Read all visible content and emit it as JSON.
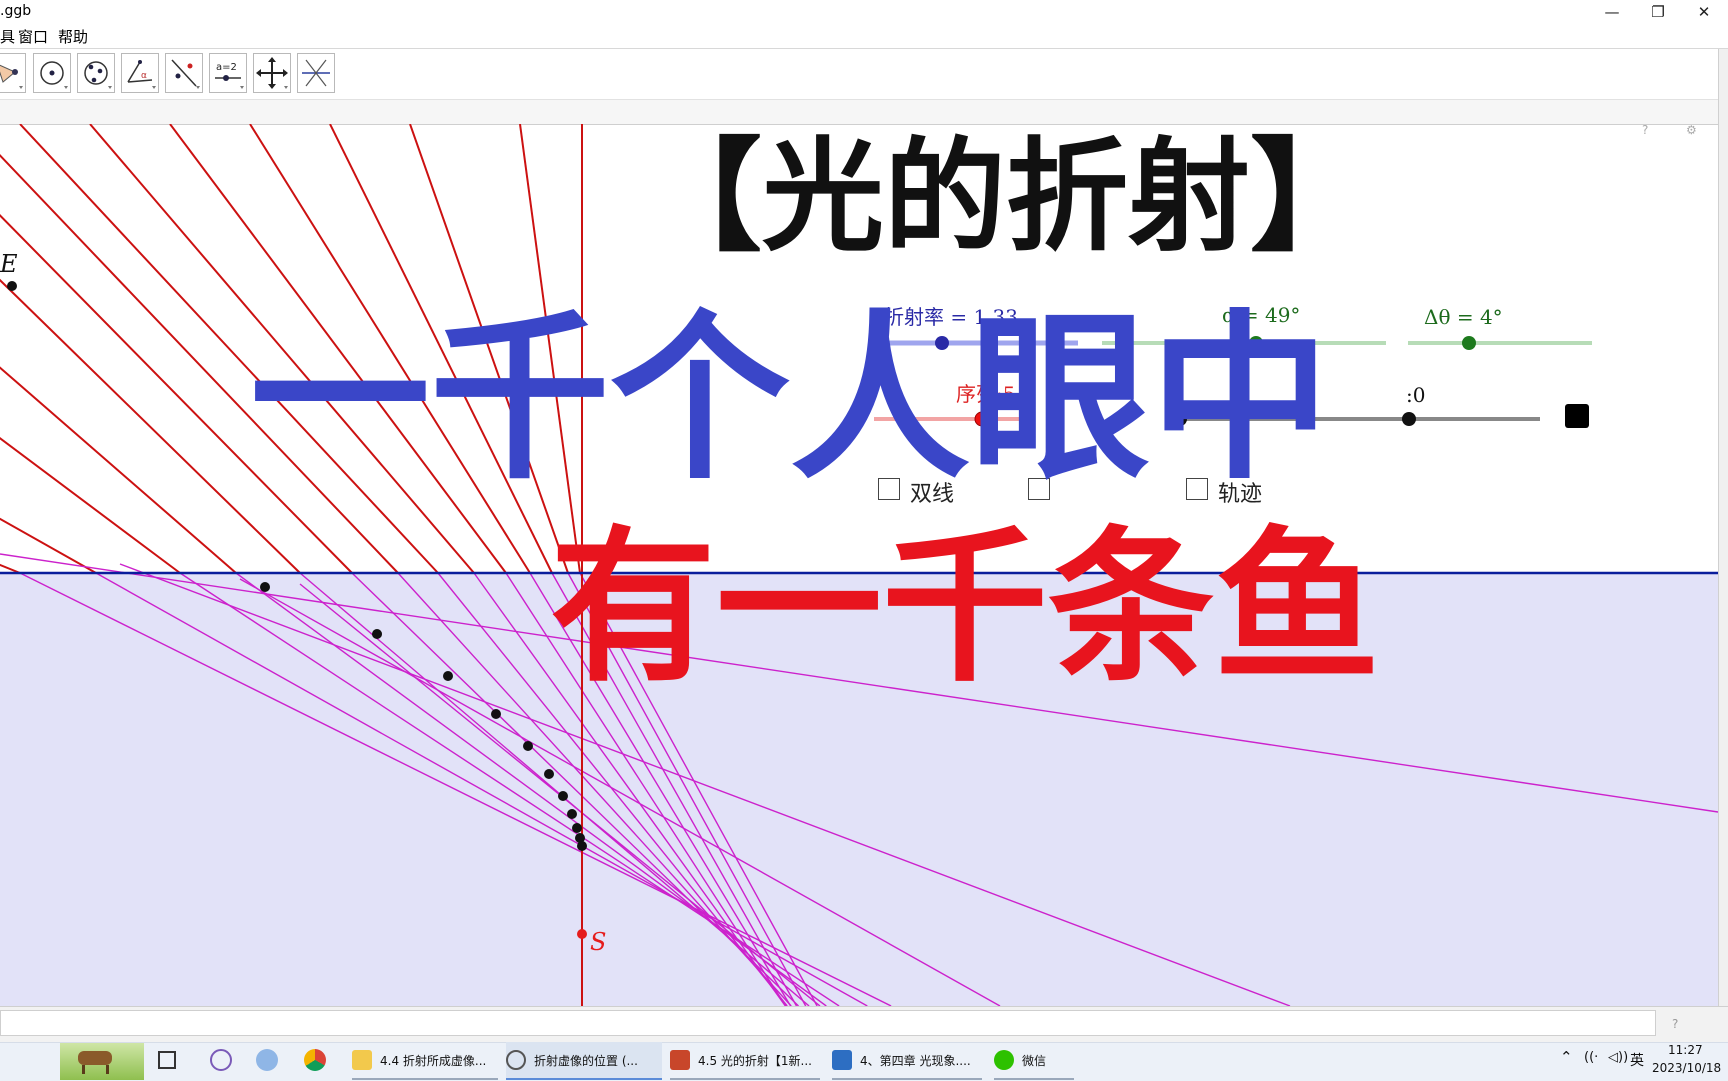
{
  "window": {
    "title": ".ggb",
    "minimize_glyph": "—",
    "restore_glyph": "❐",
    "close_glyph": "✕"
  },
  "menu": [
    "具",
    "窗口",
    "帮助"
  ],
  "toolbar": {
    "tools": [
      "polygon-tool-icon",
      "circle-center-tool-icon",
      "circle-three-points-tool-icon",
      "angle-tool-icon",
      "reflect-tool-icon",
      "slider-tool-icon",
      "move-view-tool-icon",
      "line-tool-icon"
    ],
    "slider_tool_label": "a=2",
    "undo_glyph": "↶",
    "redo_glyph": "↷",
    "help_glyph": "?",
    "settings_glyph": "⚙"
  },
  "overlays": {
    "title": "【光的折射】",
    "line1": "一千个人眼中",
    "line2": "有一千条鱼"
  },
  "geometry_view": {
    "point_E": "E",
    "point_S": "S",
    "sliders": {
      "refraction": {
        "label": "折射率 = 1.33",
        "value": 1.33
      },
      "alpha": {
        "label": "α = 49°",
        "value": 49
      },
      "delta_theta": {
        "label": "Δθ = 4°",
        "value": 4
      },
      "sequence": {
        "label": "序列:5",
        "value": 5
      },
      "partial_label": ":0"
    },
    "checkboxes": [
      {
        "label": "双线",
        "checked": false
      },
      {
        "label": "",
        "checked": false
      },
      {
        "label": "轨迹",
        "checked": false
      }
    ],
    "colors": {
      "air": "#ffffff",
      "water": "#e2e2f8",
      "interface": "#0a1e9c",
      "incident_rays": "#cc1111",
      "refracted_rays": "#cc22cc",
      "overlay_blue": "#3a46c8",
      "overlay_red": "#e8141e"
    }
  },
  "input_bar": {
    "help_glyph": "?"
  },
  "taskbar": {
    "items": [
      {
        "label": "4.4 折射所成虚像...",
        "icon": "folder-icon"
      },
      {
        "label": "折射虚像的位置 (...",
        "icon": "geogebra-icon"
      },
      {
        "label": "4.5 光的折射【1新...",
        "icon": "powerpoint-icon"
      },
      {
        "label": "4、第四章 光现象....",
        "icon": "pen-app-icon"
      },
      {
        "label": "微信",
        "icon": "wechat-icon"
      }
    ],
    "tray": {
      "ime": "英",
      "time": "11:27",
      "date": "2023/10/18"
    }
  }
}
